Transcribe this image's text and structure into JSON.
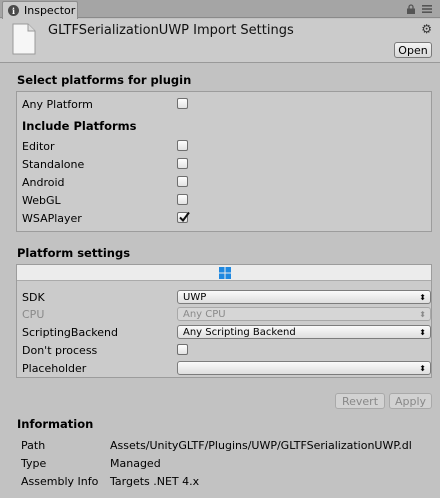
{
  "tab": {
    "label": "Inspector"
  },
  "header": {
    "title": "GLTFSerializationUWP Import Settings",
    "open_label": "Open"
  },
  "select_platforms": {
    "title": "Select platforms for plugin",
    "any_platform": {
      "label": "Any Platform",
      "checked": false
    },
    "include_title": "Include Platforms",
    "platforms": [
      {
        "label": "Editor",
        "checked": false
      },
      {
        "label": "Standalone",
        "checked": false
      },
      {
        "label": "Android",
        "checked": false
      },
      {
        "label": "WebGL",
        "checked": false
      },
      {
        "label": "WSAPlayer",
        "checked": true
      }
    ]
  },
  "platform_settings": {
    "title": "Platform settings",
    "sdk": {
      "label": "SDK",
      "value": "UWP"
    },
    "cpu": {
      "label": "CPU",
      "value": "Any CPU"
    },
    "scripting_backend": {
      "label": "ScriptingBackend",
      "value": "Any Scripting Backend"
    },
    "dont_process": {
      "label": "Don't process",
      "checked": false
    },
    "placeholder": {
      "label": "Placeholder",
      "value": ""
    }
  },
  "buttons": {
    "revert": "Revert",
    "apply": "Apply"
  },
  "information": {
    "title": "Information",
    "path": {
      "label": "Path",
      "value": "Assets/UnityGLTF/Plugins/UWP/GLTFSerializationUWP.dl"
    },
    "type": {
      "label": "Type",
      "value": "Managed"
    },
    "assembly_info": {
      "label": "Assembly Info",
      "value": "Targets .NET 4.x"
    }
  },
  "colors": {
    "window_bg": "#c2c2c2",
    "panel_bg": "#cbcbcb",
    "windows_logo": "#1f88e0"
  },
  "icons": [
    "info-icon",
    "lock-icon",
    "menu-icon",
    "file-icon",
    "gear-icon",
    "windows-icon",
    "checkmark-icon",
    "dropdown-arrow-icon"
  ]
}
